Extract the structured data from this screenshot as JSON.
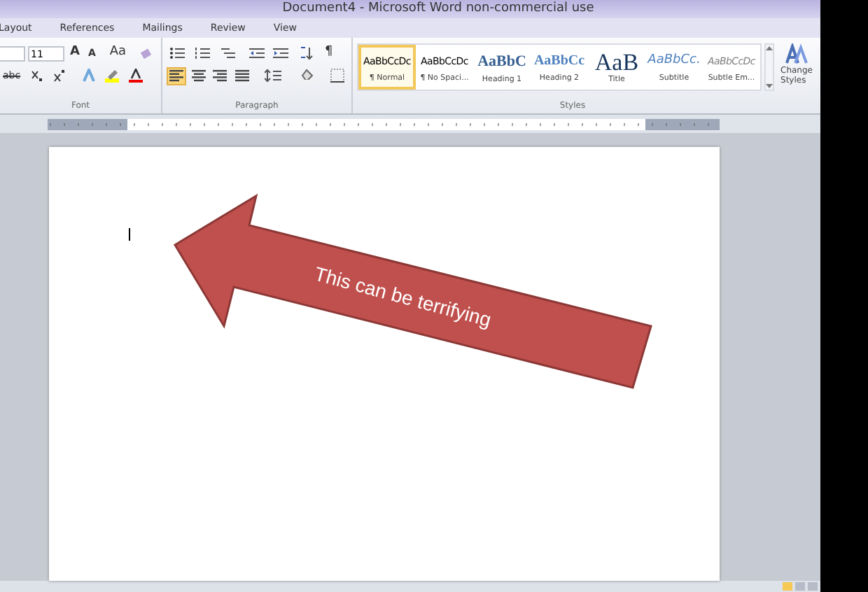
{
  "window": {
    "title": "Document4 - Microsoft Word non-commercial use"
  },
  "tabs": [
    {
      "label": "Layout",
      "selected": false
    },
    {
      "label": "References",
      "selected": false
    },
    {
      "label": "Mailings",
      "selected": false
    },
    {
      "label": "Review",
      "selected": false
    },
    {
      "label": "View",
      "selected": false
    }
  ],
  "font_group": {
    "label": "Font",
    "font_size": "11",
    "grow_font": "A",
    "shrink_font": "A",
    "change_case": "Aa",
    "strikethrough": "abc"
  },
  "paragraph_group": {
    "label": "Paragraph",
    "show_marks": "¶",
    "alignments": [
      {
        "kind": "left",
        "selected": true
      },
      {
        "kind": "center",
        "selected": false
      },
      {
        "kind": "right",
        "selected": false
      },
      {
        "kind": "justify",
        "selected": false
      }
    ]
  },
  "styles_group": {
    "label": "Styles",
    "styles": [
      {
        "preview": "AaBbCcDc",
        "name": "¶ Normal",
        "kind": "normal",
        "selected": true
      },
      {
        "preview": "AaBbCcDc",
        "name": "¶ No Spaci...",
        "kind": "normal",
        "selected": false
      },
      {
        "preview": "AaBbC",
        "name": "Heading 1",
        "kind": "heading1",
        "selected": false
      },
      {
        "preview": "AaBbCc",
        "name": "Heading 2",
        "kind": "heading2",
        "selected": false
      },
      {
        "preview": "AaB",
        "name": "Title",
        "kind": "title",
        "selected": false
      },
      {
        "preview": "AaBbCc.",
        "name": "Subtitle",
        "kind": "subtitle",
        "selected": false
      },
      {
        "preview": "AaBbCcDc",
        "name": "Subtle Em...",
        "kind": "subtle",
        "selected": false
      }
    ],
    "change_styles": "Change Styles"
  },
  "document": {
    "arrow_text": "This can be terrifying"
  }
}
